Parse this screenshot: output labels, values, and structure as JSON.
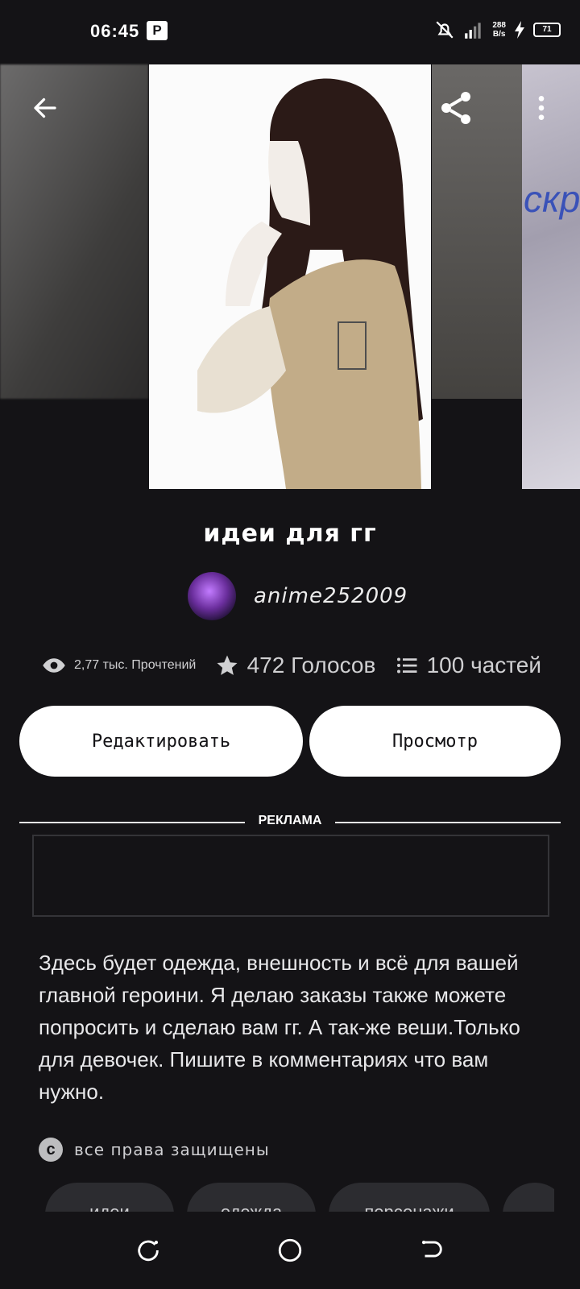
{
  "status": {
    "time": "06:45",
    "p_icon": "P",
    "net_speed_value": "288",
    "net_speed_unit": "B/s",
    "battery": "71"
  },
  "story": {
    "title": "идеи для гг",
    "author": "anime252009",
    "cover_side_text": "скр"
  },
  "stats": {
    "reads": "2,77 тыс. Прочтений",
    "votes": "472 Голосов",
    "parts": "100 частей"
  },
  "buttons": {
    "edit": "Редактировать",
    "view": "Просмотр"
  },
  "ad": {
    "label": "РЕКЛАМА"
  },
  "description": "Здесь будет одежда, внешность и всё для вашей главной героини. Я делаю заказы также можете попросить и сделаю вам гг. А так-же веши.Только для девочек. Пишите в комментариях что вам нужно.",
  "rights": {
    "icon": "c",
    "text": "все права защищены"
  },
  "tags": [
    "идеи",
    "одежда",
    "персонажи"
  ],
  "icons": {
    "back": "arrow-left-icon",
    "share": "share-icon",
    "more": "more-vertical-icon",
    "reads": "eye-icon",
    "votes": "star-icon",
    "parts": "list-icon",
    "recents": "recents-nav-icon",
    "home": "home-nav-icon",
    "back_nav": "back-nav-icon"
  }
}
